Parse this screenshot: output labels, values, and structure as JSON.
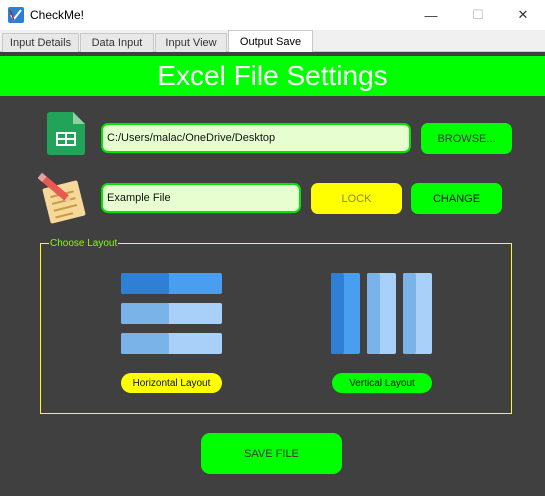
{
  "window": {
    "title": "CheckMe!",
    "minimize": "—",
    "maximize": "☐",
    "close": "✕"
  },
  "tabs": [
    {
      "label": "Input Details"
    },
    {
      "label": "Data Input"
    },
    {
      "label": "Input View"
    },
    {
      "label": "Output Save"
    }
  ],
  "header": {
    "title": "Excel File Settings"
  },
  "file_path": {
    "value": "C:/Users/malac/OneDrive/Desktop",
    "browse_label": "BROWSE..."
  },
  "file_name": {
    "value": "Example File",
    "lock_label": "LOCK",
    "change_label": "CHANGE"
  },
  "layout": {
    "group_title": "Choose Layout",
    "horizontal_label": "Horizontal Layout",
    "vertical_label": "Vertical Layout"
  },
  "save": {
    "label": "SAVE FILE"
  },
  "colors": {
    "accent_green": "#00ff00",
    "accent_yellow": "#ffff00",
    "panel_bg": "#404040",
    "input_bg": "#e7ffd0"
  },
  "icons": {
    "app": "checkmark-app-icon",
    "spreadsheet": "google-sheets-icon",
    "notepad": "notepad-pencil-icon",
    "horizontal": "horizontal-layout-icon",
    "vertical": "vertical-layout-icon"
  }
}
